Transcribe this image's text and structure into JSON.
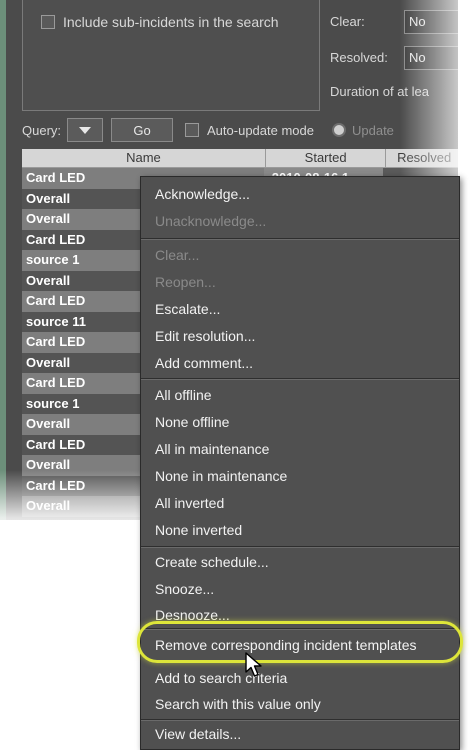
{
  "search": {
    "include_sub_incidents_label": "Include sub-incidents in the search",
    "clear_label": "Clear:",
    "clear_value": "No",
    "resolved_label": "Resolved:",
    "resolved_value": "No",
    "duration_label": "Duration of at lea"
  },
  "query_bar": {
    "query_label": "Query:",
    "go_label": "Go",
    "auto_update_label": "Auto-update mode",
    "update_label": "Update"
  },
  "table": {
    "columns": [
      "Name",
      "Started",
      "Resolved"
    ],
    "rows": [
      {
        "name": "Card LED",
        "started": "2010-08-16 1"
      },
      {
        "name": "Overall",
        "started": ""
      },
      {
        "name": "Overall",
        "started": ""
      },
      {
        "name": "Card LED",
        "started": ""
      },
      {
        "name": "source 1",
        "started": ""
      },
      {
        "name": "Overall",
        "started": ""
      },
      {
        "name": "Card LED",
        "started": ""
      },
      {
        "name": "source 11",
        "started": ""
      },
      {
        "name": "Card LED",
        "started": ""
      },
      {
        "name": "Overall",
        "started": ""
      },
      {
        "name": "Card LED",
        "started": ""
      },
      {
        "name": "source 1",
        "started": ""
      },
      {
        "name": "Overall",
        "started": ""
      },
      {
        "name": "Card LED",
        "started": ""
      },
      {
        "name": "Overall",
        "started": ""
      },
      {
        "name": "Card LED",
        "started": ""
      },
      {
        "name": "Overall",
        "started": ""
      }
    ]
  },
  "context_menu": {
    "acknowledge": "Acknowledge...",
    "unacknowledge": "Unacknowledge...",
    "clear": "Clear...",
    "reopen": "Reopen...",
    "escalate": "Escalate...",
    "edit_resolution": "Edit resolution...",
    "add_comment": "Add comment...",
    "all_offline": "All offline",
    "none_offline": "None offline",
    "all_in_maintenance": "All in maintenance",
    "none_in_maintenance": "None in maintenance",
    "all_inverted": "All inverted",
    "none_inverted": "None inverted",
    "create_schedule": "Create schedule...",
    "snooze": "Snooze...",
    "desnooze": "Desnooze...",
    "remove_templates": "Remove corresponding incident templates",
    "add_to_search": "Add to search criteria",
    "search_with_value": "Search with this value only",
    "view_details": "View details..."
  },
  "colors": {
    "menu_bg": "#505050",
    "highlight": "#dde53a"
  }
}
